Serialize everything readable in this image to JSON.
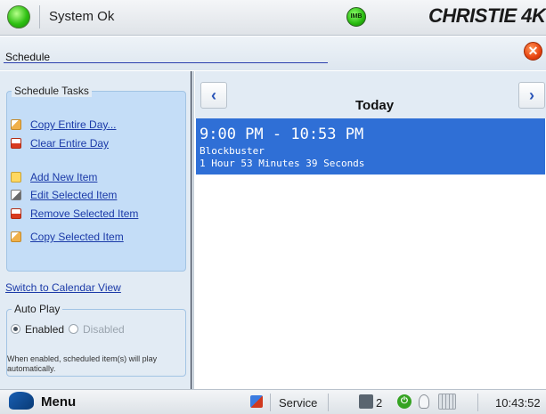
{
  "topbar": {
    "status_text": "System Ok",
    "imb_label": "IMB",
    "brand": "CHRISTIE 4K"
  },
  "header": {
    "title": "Schedule"
  },
  "left_panel": {
    "tasks_title": "Schedule Tasks",
    "tasks": [
      {
        "label": "Copy Entire Day...",
        "icon": "copy-icon"
      },
      {
        "label": "Clear Entire Day",
        "icon": "clear-icon"
      },
      {
        "label": "Add New Item",
        "icon": "add-icon"
      },
      {
        "label": "Edit Selected Item",
        "icon": "edit-icon"
      },
      {
        "label": "Remove Selected Item",
        "icon": "remove-icon"
      },
      {
        "label": "Copy Selected Item",
        "icon": "copy-icon"
      }
    ],
    "switch_view": "Switch to Calendar View",
    "autoplay": {
      "title": "Auto Play",
      "enabled_label": "Enabled",
      "disabled_label": "Disabled",
      "selected": "Enabled",
      "note": "When enabled, scheduled item(s) will play automatically."
    }
  },
  "calendar": {
    "day_label": "Today",
    "prev_label": "‹",
    "next_label": "›",
    "events": [
      {
        "time": "9:00 PM - 10:53 PM",
        "title": "Blockbuster",
        "duration": "1 Hour 53 Minutes 39 Seconds"
      }
    ]
  },
  "bottombar": {
    "menu_label": "Menu",
    "service_label": "Service",
    "count": "2",
    "time": "10:43:52"
  },
  "colors": {
    "accent_blue": "#2f6fd6",
    "panel_bg": "#e2ebf4",
    "tasks_bg": "#c4ddf7",
    "link": "#1b3aa8",
    "status_green": "#2ec012"
  }
}
